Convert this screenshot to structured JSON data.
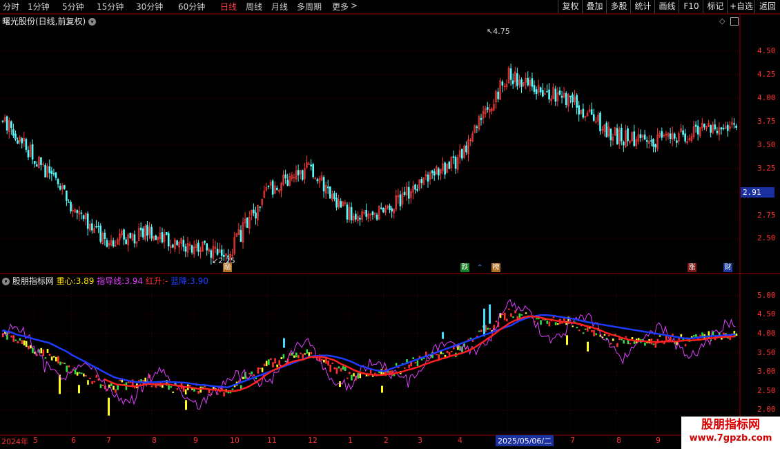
{
  "toolbar": {
    "periods": [
      "分时",
      "1分钟",
      "5分钟",
      "15分钟",
      "30分钟",
      "60分钟",
      "日线",
      "周线",
      "月线",
      "多周期",
      "更多"
    ],
    "more_arrow": ">",
    "buttons": [
      "复权",
      "叠加",
      "多股",
      "统计",
      "画线",
      "F10",
      "标记",
      "+自选",
      "返回"
    ]
  },
  "main_pane": {
    "title": "曙光股份(日线,前复权)",
    "high_label": "4.75",
    "low_label": "2.25",
    "y_ticks": [
      "4.50",
      "4.25",
      "4.00",
      "3.75",
      "3.50",
      "3.25",
      "2.75",
      "2.50"
    ],
    "current_price": "2.91",
    "events": [
      "融",
      "跌",
      "榜",
      "涨",
      "财"
    ]
  },
  "indicator_pane": {
    "name": "股朋指标网",
    "zhongxin_label": "重心:",
    "zhongxin_value": "3.89",
    "zhidao_label": "指导线:",
    "zhidao_value": "3.94",
    "hongsheng_label": "红升:",
    "hongsheng_value": "-",
    "lanjiang_label": "蓝降:",
    "lanjiang_value": "3.90",
    "y_ticks": [
      "5.00",
      "4.50",
      "4.00",
      "3.50",
      "3.00",
      "2.50",
      "2.00"
    ]
  },
  "x_axis": {
    "months": [
      "2024年",
      "5",
      "6",
      "7",
      "8",
      "9",
      "10",
      "11",
      "12",
      "1",
      "2",
      "3",
      "4",
      "7",
      "8",
      "9"
    ],
    "cursor_date": "2025/05/06/二"
  },
  "watermark": {
    "line1": "股朋指标网",
    "line2": "www.7gpzb.com"
  },
  "colors": {
    "up": "#ff3b3b",
    "down": "#54ffff",
    "bg": "#000000",
    "grid": "#5a0000",
    "blue_line": "#1e3cff",
    "red_line": "#ff2020",
    "magenta": "#e040ff"
  },
  "chart_data": {
    "type": "line",
    "close_price_waypoints": {
      "x": [
        "2024-04",
        "2024-05",
        "2024-06",
        "2024-07",
        "2024-08",
        "2024-09",
        "2024-10",
        "2024-11",
        "2024-12",
        "2025-01",
        "2025-02",
        "2025-03",
        "2025-04",
        "2025-05",
        "2025-06",
        "2025-07",
        "2025-08",
        "2025-09"
      ],
      "y": [
        3.9,
        3.5,
        2.95,
        2.55,
        2.65,
        2.45,
        2.45,
        3.1,
        3.35,
        2.85,
        2.85,
        3.2,
        3.45,
        4.4,
        4.1,
        3.7,
        3.65,
        3.85
      ]
    },
    "ylim_price": [
      2.25,
      4.85
    ],
    "ylim_indicator": [
      1.9,
      5.3
    ]
  }
}
